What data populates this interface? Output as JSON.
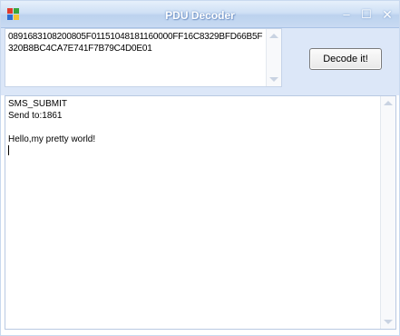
{
  "window": {
    "title": "PDU Decoder",
    "controls": {
      "minimize": "–",
      "maximize": "☐",
      "close": "✕"
    }
  },
  "input": {
    "pdu_text": "0891683108200805F01151048181160000FF16C8329BFD66B5F320B8BC4CA7E741F7B79C4D0E01"
  },
  "toolbar": {
    "decode_label": "Decode it!"
  },
  "output": {
    "lines": [
      "SMS_SUBMIT",
      "Send to:1861",
      "",
      "Hello,my pretty world!"
    ]
  },
  "colors": {
    "titlebar": "#c8daf2",
    "panel": "#dce7f8",
    "border": "#b9c9e2"
  }
}
